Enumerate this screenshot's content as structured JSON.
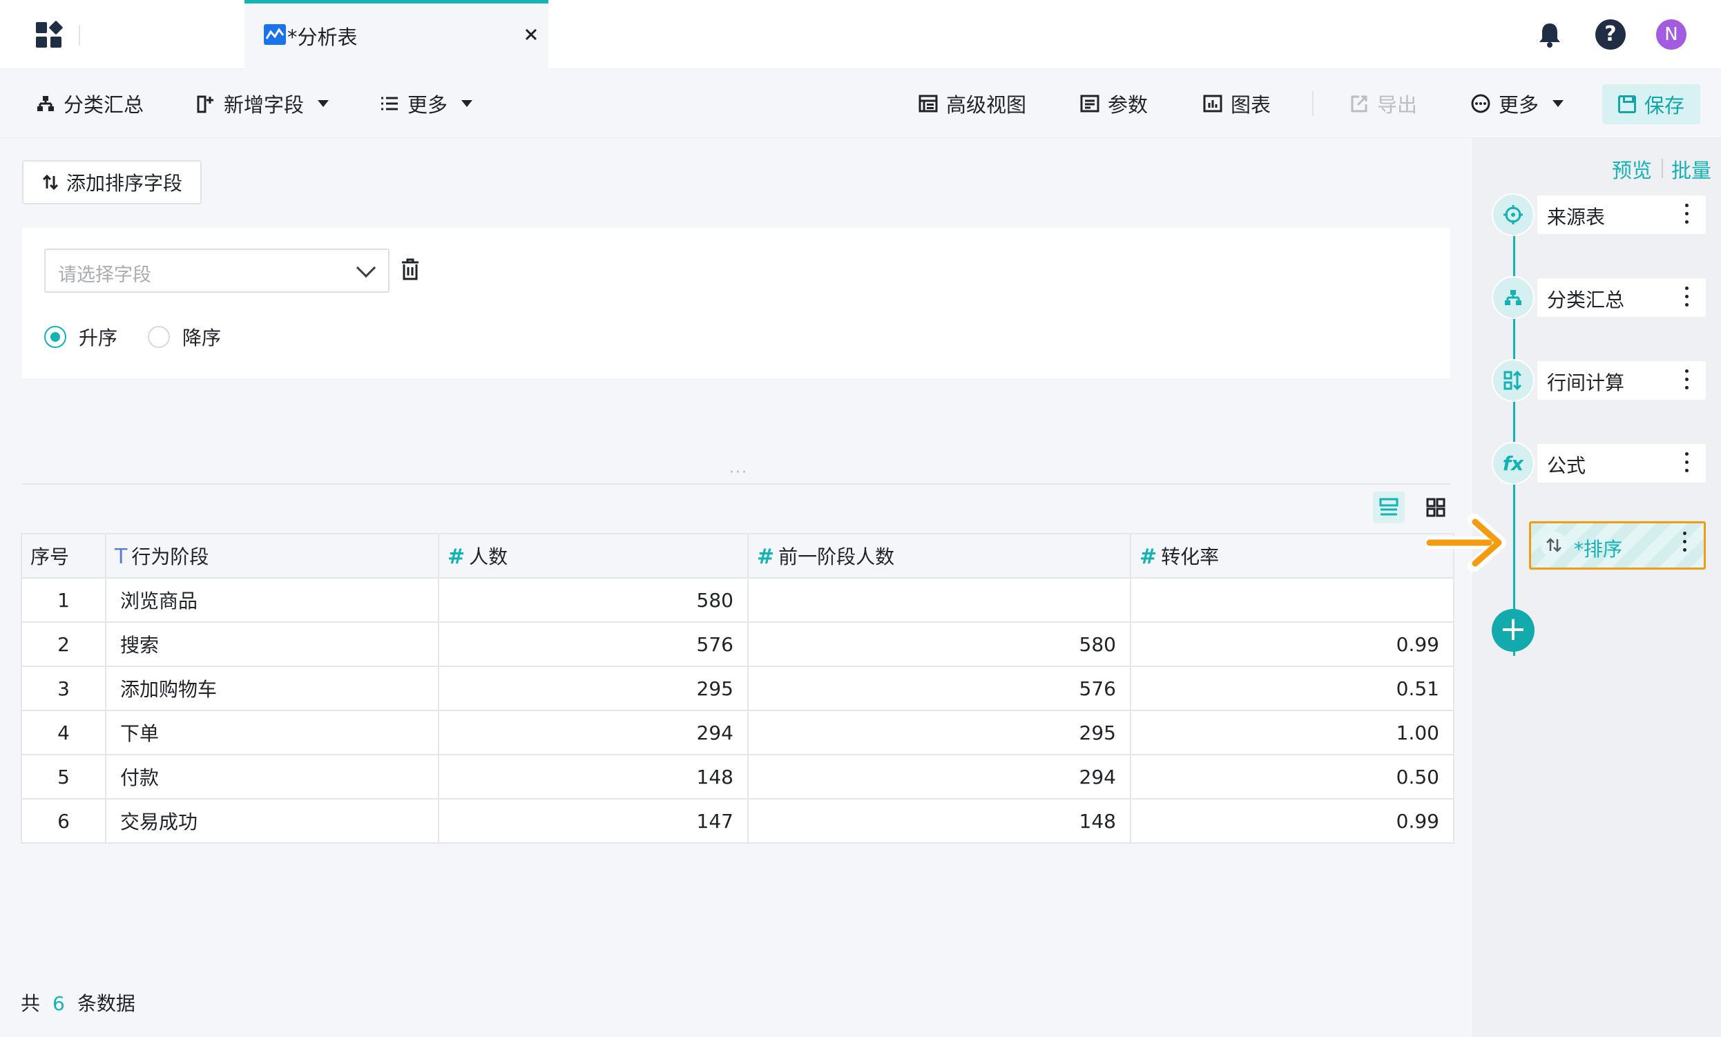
{
  "window": {
    "tab_title": "*分析表",
    "user_initial": "N"
  },
  "toolbar": {
    "group_summary": "分类汇总",
    "add_field": "新增字段",
    "more_left": "更多",
    "advanced_view": "高级视图",
    "params": "参数",
    "chart": "图表",
    "export": "导出",
    "more_right": "更多",
    "save": "保存"
  },
  "sort_panel": {
    "add_sort_field": "添加排序字段",
    "field_placeholder": "请选择字段",
    "ascending": "升序",
    "descending": "降序",
    "selected_order": "ascending"
  },
  "table": {
    "headers": {
      "index": "序号",
      "stage": "行为阶段",
      "count": "人数",
      "prev_count": "前一阶段人数",
      "rate": "转化率"
    },
    "rows": [
      {
        "idx": "1",
        "stage": "浏览商品",
        "count": "580",
        "prev": "",
        "rate": ""
      },
      {
        "idx": "2",
        "stage": "搜索",
        "count": "576",
        "prev": "580",
        "rate": "0.99"
      },
      {
        "idx": "3",
        "stage": "添加购物车",
        "count": "295",
        "prev": "576",
        "rate": "0.51"
      },
      {
        "idx": "4",
        "stage": "下单",
        "count": "294",
        "prev": "295",
        "rate": "1.00"
      },
      {
        "idx": "5",
        "stage": "付款",
        "count": "148",
        "prev": "294",
        "rate": "0.50"
      },
      {
        "idx": "6",
        "stage": "交易成功",
        "count": "147",
        "prev": "148",
        "rate": "0.99"
      }
    ]
  },
  "footer": {
    "prefix": "共",
    "count": "6",
    "suffix": "条数据"
  },
  "pipeline": {
    "preview": "预览",
    "batch": "批量",
    "steps": [
      {
        "label": "来源表",
        "icon": "crosshair-icon"
      },
      {
        "label": "分类汇总",
        "icon": "hierarchy-icon"
      },
      {
        "label": "行间计算",
        "icon": "row-calc-icon"
      },
      {
        "label": "公式",
        "icon": "fx-icon"
      },
      {
        "label": "*排序",
        "icon": "sort-icon",
        "active": true
      }
    ]
  },
  "colors": {
    "accent": "#12b2b5",
    "highlight": "#f39c12",
    "avatar": "#a35ce0"
  }
}
